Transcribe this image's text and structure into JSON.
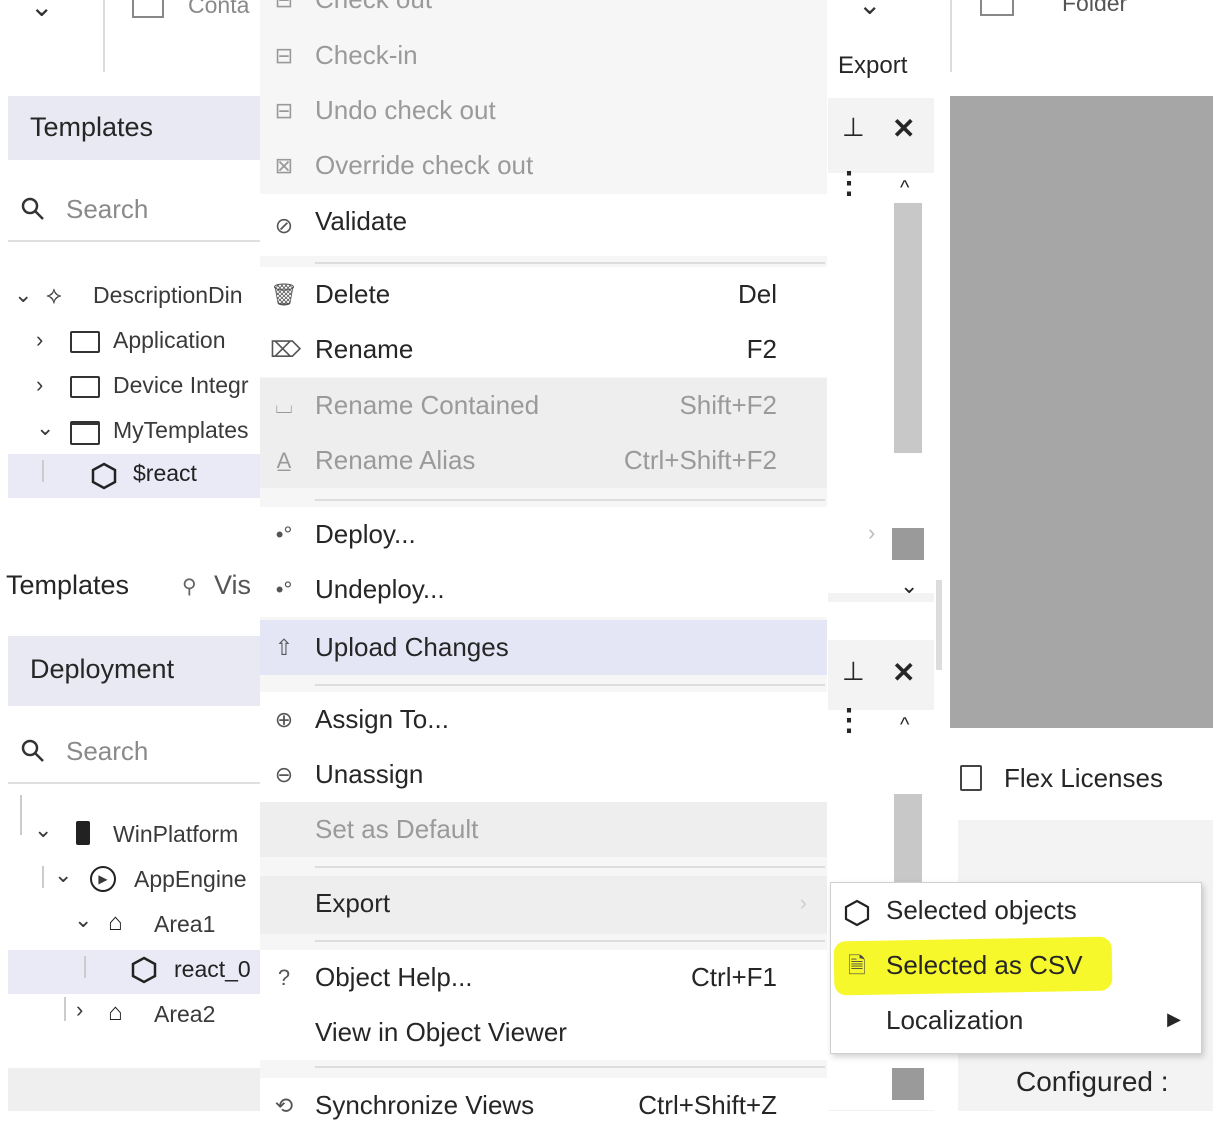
{
  "top_toolbar": {
    "left_partial": "Conta",
    "menu_partial": "Check out",
    "export_label": "Export",
    "folder_partial": "Folder"
  },
  "templates_pane": {
    "title": "Templates",
    "search_placeholder": "Search",
    "tree": [
      {
        "label": "DescriptionDin",
        "icon": "template-icon"
      },
      {
        "label": "Application",
        "icon": "folder-icon"
      },
      {
        "label": "Device Integr",
        "icon": "folder-icon"
      },
      {
        "label": "MyTemplates",
        "icon": "folder-open-icon"
      },
      {
        "label": "$react",
        "icon": "hexagon-icon"
      }
    ]
  },
  "lower_tabs": {
    "templates_tab": "Templates",
    "vis_tab": "Vis"
  },
  "deployment_pane": {
    "title": "Deployment",
    "search_placeholder": "Search",
    "tree": [
      {
        "label": "WinPlatform",
        "icon": "platform-icon"
      },
      {
        "label": "AppEngine",
        "icon": "engine-icon"
      },
      {
        "label": "Area1",
        "icon": "area-icon"
      },
      {
        "label": "react_0",
        "icon": "hexagon-icon"
      },
      {
        "label": "Area2",
        "icon": "area-icon"
      }
    ]
  },
  "context_menu": {
    "items": [
      {
        "label": "Check-in",
        "shortcut": "",
        "disabled": true
      },
      {
        "label": "Undo check out",
        "shortcut": "",
        "disabled": true
      },
      {
        "label": "Override check out",
        "shortcut": "",
        "disabled": true
      },
      {
        "label": "Validate",
        "shortcut": "",
        "disabled": false
      },
      {
        "label": "Delete",
        "shortcut": "Del",
        "disabled": false
      },
      {
        "label": "Rename",
        "shortcut": "F2",
        "disabled": false
      },
      {
        "label": "Rename Contained",
        "shortcut": "Shift+F2",
        "disabled": true
      },
      {
        "label": "Rename Alias",
        "shortcut": "Ctrl+Shift+F2",
        "disabled": true
      },
      {
        "label": "Deploy...",
        "shortcut": "",
        "disabled": false
      },
      {
        "label": "Undeploy...",
        "shortcut": "",
        "disabled": false
      },
      {
        "label": "Upload Changes",
        "shortcut": "",
        "disabled": false
      },
      {
        "label": "Assign To...",
        "shortcut": "",
        "disabled": false
      },
      {
        "label": "Unassign",
        "shortcut": "",
        "disabled": false
      },
      {
        "label": "Set as Default",
        "shortcut": "",
        "disabled": true
      },
      {
        "label": "Export",
        "shortcut": "",
        "disabled": false
      },
      {
        "label": "Object Help...",
        "shortcut": "Ctrl+F1",
        "disabled": false
      },
      {
        "label": "View in Object Viewer",
        "shortcut": "",
        "disabled": false
      },
      {
        "label": "Synchronize Views",
        "shortcut": "Ctrl+Shift+Z",
        "disabled": false
      }
    ]
  },
  "export_submenu": {
    "items": [
      {
        "label": "Selected objects"
      },
      {
        "label": "Selected as CSV"
      },
      {
        "label": "Localization"
      }
    ]
  },
  "right_pane": {
    "flex_licenses": "Flex Licenses",
    "configured": "Configured :"
  },
  "colors": {
    "highlight_yellow": "#f6f82c",
    "menu_hover": "#e4e6f5",
    "pane_header": "#e8e9f2",
    "canvas_grey": "#a6a6a6"
  }
}
